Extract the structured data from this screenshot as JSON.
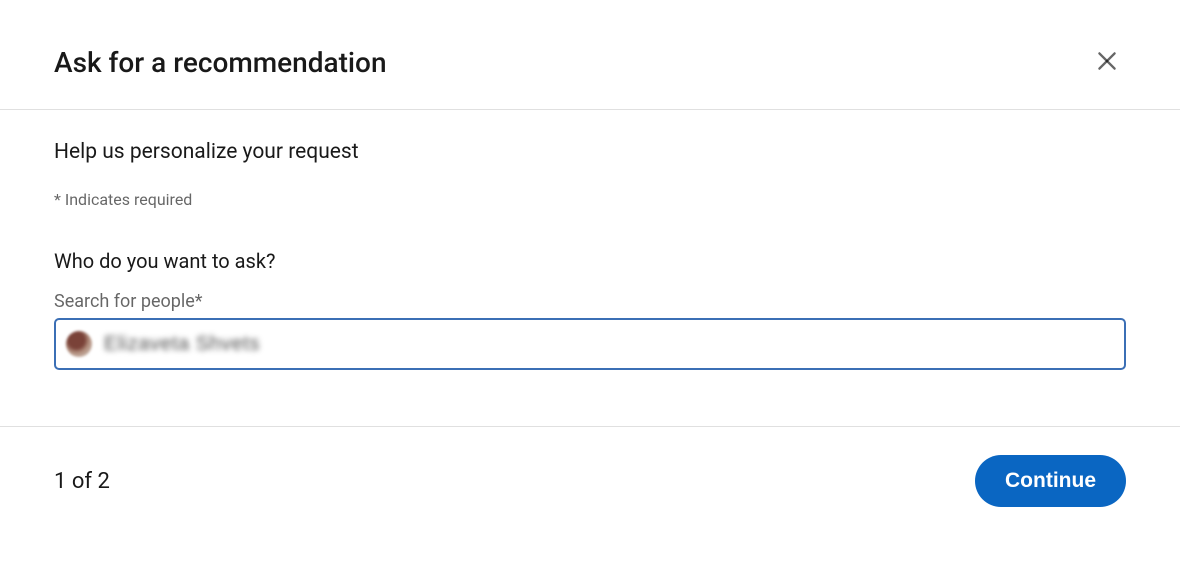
{
  "header": {
    "title": "Ask for a recommendation"
  },
  "body": {
    "subtitle": "Help us personalize your request",
    "required_note": "* Indicates required",
    "question": "Who do you want to ask?",
    "search_label": "Search for people*",
    "search_value": "Elizaveta Shvets"
  },
  "footer": {
    "step_text": "1 of 2",
    "continue_label": "Continue"
  }
}
